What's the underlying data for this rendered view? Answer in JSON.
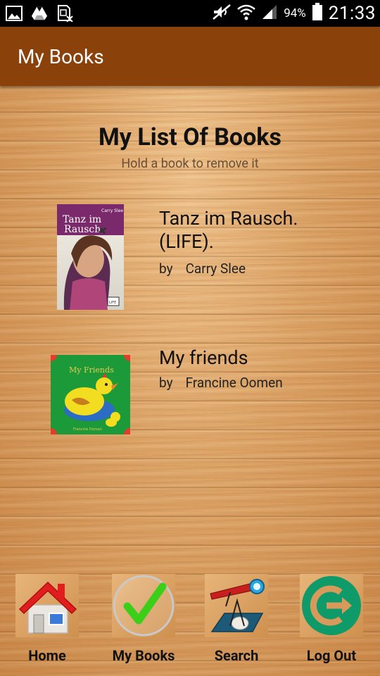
{
  "status_bar": {
    "battery_percent": "94%",
    "time": "21:33",
    "left_icons": [
      "image-icon",
      "drive-icon",
      "sim-icon"
    ],
    "right_icons": [
      "mute-icon",
      "wifi-icon",
      "signal-icon",
      "battery-icon"
    ]
  },
  "app_bar": {
    "title": "My Books"
  },
  "main": {
    "title": "My List Of Books",
    "subtitle": "Hold a book to remove it",
    "books": [
      {
        "title": "Tanz im Rausch. (LIFE).",
        "by_label": "by",
        "author": "Carry Slee",
        "cover": {
          "title_text": "Tanz im Rausch",
          "author_text": "Carry Slee",
          "badge": "LIFE"
        }
      },
      {
        "title": "My friends",
        "by_label": "by",
        "author": "Francine Oomen",
        "cover": {
          "title_text": "My Friends",
          "author_text": "Francine Oomen"
        }
      }
    ]
  },
  "bottom_nav": {
    "items": [
      {
        "label": "Home",
        "icon": "home-icon"
      },
      {
        "label": "My Books",
        "icon": "checkmark-icon"
      },
      {
        "label": "Search",
        "icon": "telescope-icon"
      },
      {
        "label": "Log Out",
        "icon": "logout-icon"
      }
    ]
  },
  "colors": {
    "app_bar": "#8a420a",
    "status_bar": "#000000",
    "wood": "#d9a063",
    "logout_green": "#0f9a6a",
    "check_green": "#3ccf1a"
  }
}
